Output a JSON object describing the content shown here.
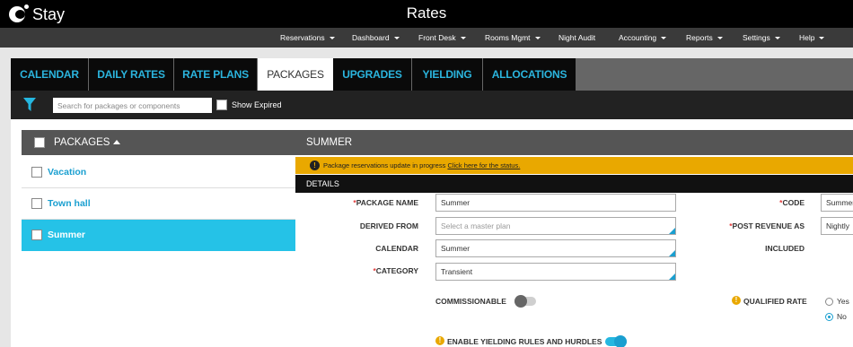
{
  "app": {
    "logo_text": "Stay",
    "title": "Rates"
  },
  "nav": [
    {
      "label": "Reservations",
      "dropdown": true
    },
    {
      "label": "Dashboard",
      "dropdown": true
    },
    {
      "label": "Front Desk",
      "dropdown": true
    },
    {
      "label": "Rooms Mgmt",
      "dropdown": true
    },
    {
      "label": "Night Audit",
      "dropdown": false
    },
    {
      "label": "Accounting",
      "dropdown": true
    },
    {
      "label": "Reports",
      "dropdown": true
    },
    {
      "label": "Settings",
      "dropdown": true
    },
    {
      "label": "Help",
      "dropdown": true
    }
  ],
  "tabs": [
    {
      "label": "CALENDAR",
      "active": false
    },
    {
      "label": "DAILY RATES",
      "active": false
    },
    {
      "label": "RATE PLANS",
      "active": false
    },
    {
      "label": "PACKAGES",
      "active": true
    },
    {
      "label": "UPGRADES",
      "active": false
    },
    {
      "label": "YIELDING",
      "active": false
    },
    {
      "label": "ALLOCATIONS",
      "active": false
    }
  ],
  "filter": {
    "search_placeholder": "Search for packages or components",
    "show_expired_label": "Show Expired",
    "show_expired_checked": false
  },
  "packages": {
    "header": "PACKAGES",
    "items": [
      {
        "label": "Vacation",
        "selected": false
      },
      {
        "label": "Town hall",
        "selected": false
      },
      {
        "label": "Summer",
        "selected": true
      }
    ]
  },
  "detail": {
    "title": "SUMMER",
    "alert": {
      "text": "Package reservations update in progress",
      "link": "Click here for the status."
    },
    "section_title": "DETAILS",
    "fields": {
      "package_name": {
        "label": "PACKAGE NAME",
        "value": "Summer"
      },
      "derived_from": {
        "label": "DERIVED FROM",
        "placeholder": "Select a master plan"
      },
      "calendar": {
        "label": "CALENDAR",
        "value": "Summer"
      },
      "category": {
        "label": "CATEGORY",
        "value": "Transient"
      },
      "code": {
        "label": "CODE",
        "value": "Summer"
      },
      "post_revenue_as": {
        "label": "POST REVENUE AS",
        "value": "Nightly"
      },
      "included": {
        "label": "INCLUDED"
      }
    },
    "commissionable": {
      "label": "COMMISSIONABLE",
      "on": false
    },
    "qualified_rate": {
      "label": "QUALIFIED RATE",
      "options": [
        "Yes",
        "No"
      ],
      "selected": "No"
    },
    "yielding": {
      "label": "ENABLE YIELDING RULES AND HURDLES",
      "on": true
    }
  },
  "colors": {
    "accent": "#1a9fd0",
    "selected_row": "#25c2e7",
    "alert": "#e9a800",
    "required": "#e23a3a"
  }
}
